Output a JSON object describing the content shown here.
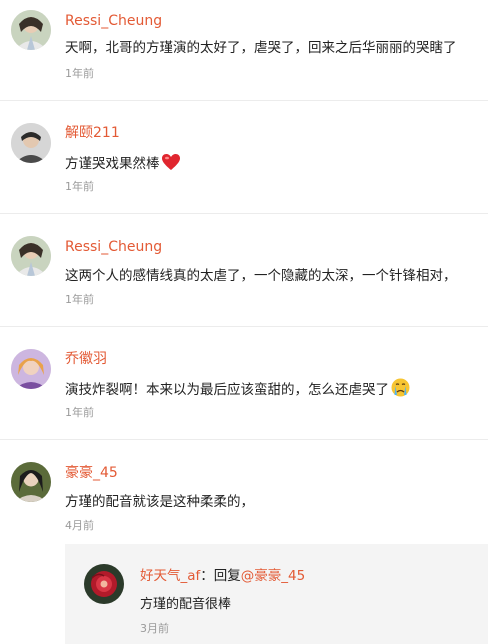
{
  "comments": [
    {
      "username": "Ressi_Cheung",
      "text": "天啊，北哥的方瑾演的太好了，虐哭了，回来之后华丽丽的哭瞎了",
      "time": "1年前",
      "avatar": "avatar-photo"
    },
    {
      "username": "解颐211",
      "text": "方谨哭戏果然棒",
      "time": "1年前",
      "avatar": "avatar-photo",
      "emoji": "red-heart-icon"
    },
    {
      "username": "Ressi_Cheung",
      "text": "这两个人的感情线真的太虐了，一个隐藏的太深，一个针锋相对，",
      "time": "1年前",
      "avatar": "avatar-photo"
    },
    {
      "username": "乔徽羽",
      "text": "演技炸裂啊！本来以为最后应该蛮甜的，怎么还虐哭了",
      "time": "1年前",
      "avatar": "avatar-photo",
      "emoji": "crying-face-icon"
    },
    {
      "username": "豪豪_45",
      "text": "方瑾的配音就该是这种柔柔的，",
      "time": "4月前",
      "avatar": "avatar-photo"
    }
  ],
  "reply": {
    "username": "好天气_af",
    "reply_prefix": "：回复",
    "reply_target": "@豪豪_45",
    "text": "方瑾的配音很棒",
    "time": "3月前"
  },
  "colors": {
    "username": "#e35a35",
    "text": "#222222",
    "time": "#9a9a9a",
    "divider": "#ececec",
    "reply_bg": "#f4f4f4"
  }
}
